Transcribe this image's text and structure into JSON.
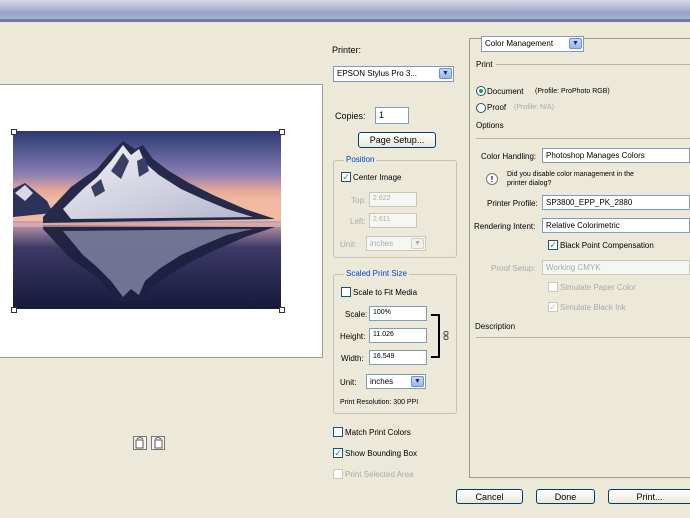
{
  "printer": {
    "label": "Printer:",
    "value": "EPSON Stylus Pro 3..."
  },
  "copies": {
    "label": "Copies:",
    "value": "1"
  },
  "page_setup_label": "Page Setup...",
  "position": {
    "title": "Position",
    "center_image": "Center Image",
    "top_label": "Top:",
    "top_value": "2.622",
    "left_label": "Left:",
    "left_value": "2.611",
    "unit_label": "Unit:",
    "unit_value": "inches"
  },
  "scaled": {
    "title": "Scaled Print Size",
    "scale_to_fit": "Scale to Fit Media",
    "scale_label": "Scale:",
    "scale_value": "100%",
    "height_label": "Height:",
    "height_value": "11.026",
    "width_label": "Width:",
    "width_value": "16.549",
    "unit_label": "Unit:",
    "unit_value": "inches",
    "resolution": "Print Resolution: 300 PPI"
  },
  "bottom_checks": {
    "match": "Match Print Colors",
    "bounding": "Show Bounding Box",
    "selected": "Print Selected Area"
  },
  "right": {
    "mode": "Color Management",
    "print_section": "Print",
    "document_label": "Document",
    "document_profile": "(Profile: ProPhoto RGB)",
    "proof_label": "Proof",
    "proof_profile": "(Profile: N/A)",
    "options": "Options",
    "color_handling_label": "Color Handling:",
    "color_handling_value": "Photoshop Manages Colors",
    "warning": "Did you disable color management in the printer dialog?",
    "printer_profile_label": "Printer Profile:",
    "printer_profile_value": "SP3800_EPP_PK_2880",
    "rendering_label": "Rendering Intent:",
    "rendering_value": "Relative Colorimetric",
    "black_point": "Black Point Compensation",
    "proof_setup_label": "Proof Setup:",
    "proof_setup_value": "Working CMYK",
    "simulate_paper": "Simulate Paper Color",
    "simulate_black": "Simulate Black Ink",
    "description": "Description"
  },
  "buttons": {
    "cancel": "Cancel",
    "done": "Done",
    "print": "Print..."
  },
  "colors": {
    "accent": "#0046d5",
    "check": "#21a121"
  }
}
